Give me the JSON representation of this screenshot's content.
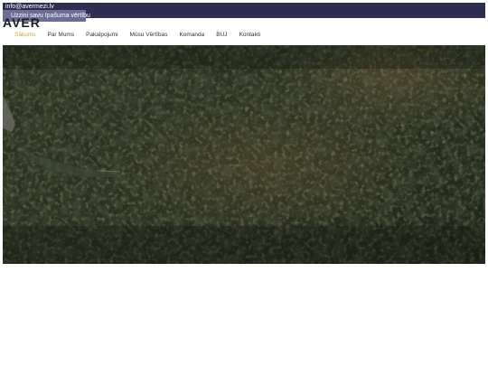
{
  "topbar": {
    "email": "info@avermezi.lv",
    "cta_label": "Uzzini savu īpašuma vērtību"
  },
  "brand": {
    "logo": "AVER"
  },
  "nav": {
    "items": [
      {
        "label": "Sākums",
        "active": true
      },
      {
        "label": "Par Mums",
        "active": false
      },
      {
        "label": "Pakalpojumi",
        "active": false
      },
      {
        "label": "Mūsu Vērtības",
        "active": false
      },
      {
        "label": "Komanda",
        "active": false
      },
      {
        "label": "BUJ",
        "active": false
      },
      {
        "label": "Kontakti",
        "active": false
      }
    ]
  },
  "hero": {
    "image": "aerial-forest-photo"
  },
  "colors": {
    "topbar": "#2e2e52",
    "cta": "#6c6c94",
    "active_nav": "#d2a43a"
  }
}
